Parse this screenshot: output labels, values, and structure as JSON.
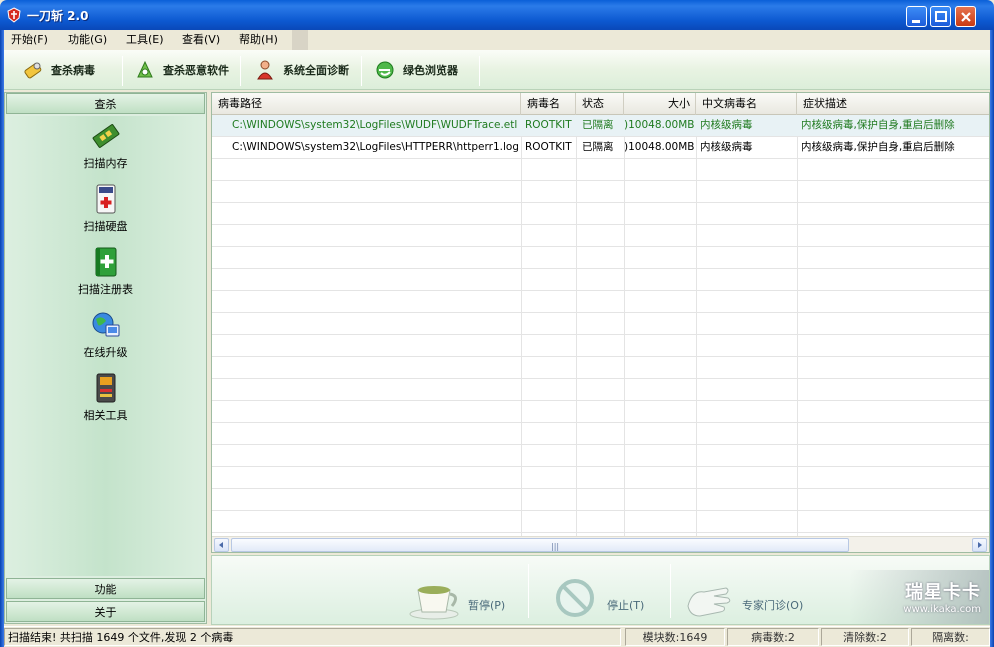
{
  "window": {
    "title": "一刀斩 2.0"
  },
  "menu": [
    {
      "label": "开始(F)"
    },
    {
      "label": "功能(G)"
    },
    {
      "label": "工具(E)"
    },
    {
      "label": "查看(V)"
    },
    {
      "label": "帮助(H)"
    }
  ],
  "toolbar": [
    {
      "label": "查杀病毒",
      "icon": "antivirus-scan-icon"
    },
    {
      "label": "查杀恶意软件",
      "icon": "malware-scan-icon"
    },
    {
      "label": "系统全面诊断",
      "icon": "system-diagnose-icon"
    },
    {
      "label": "绿色浏览器",
      "icon": "green-browser-icon"
    }
  ],
  "sidebar": {
    "active_section": "查杀",
    "items": [
      {
        "label": "扫描内存",
        "icon": "memory-chip-icon"
      },
      {
        "label": "扫描硬盘",
        "icon": "disk-icon"
      },
      {
        "label": "扫描注册表",
        "icon": "registry-book-icon"
      },
      {
        "label": "在线升级",
        "icon": "globe-update-icon"
      },
      {
        "label": "相关工具",
        "icon": "tools-icon"
      }
    ],
    "sections_bottom": [
      "功能",
      "关于"
    ]
  },
  "table": {
    "columns": [
      "病毒路径",
      "病毒名",
      "状态",
      "大小",
      "中文病毒名",
      "症状描述"
    ],
    "rows": [
      {
        "path": "C:\\WINDOWS\\system32\\LogFiles\\WUDF\\WUDFTrace.etl",
        "name": "ROOTKIT",
        "status": "已隔离",
        "size": ")10048.00MB",
        "cn_name": "内核级病毒",
        "desc": "内核级病毒,保护自身,重启后删除"
      },
      {
        "path": "C:\\WINDOWS\\system32\\LogFiles\\HTTPERR\\httperr1.log",
        "name": "ROOTKIT",
        "status": "已隔离",
        "size": ")10048.00MB",
        "cn_name": "内核级病毒",
        "desc": "内核级病毒,保护自身,重启后删除"
      }
    ]
  },
  "actions": [
    {
      "label": "暂停(P)",
      "icon": "coffee-cup-icon"
    },
    {
      "label": "停止(T)",
      "icon": "stop-sign-icon"
    },
    {
      "label": "专家门诊(O)",
      "icon": "hand-icon"
    }
  ],
  "watermark": {
    "line1": "瑞星卡卡",
    "line2": "www.ikaka.com"
  },
  "status": {
    "message": "扫描结束! 共扫描 1649 个文件,发现 2 个病毒",
    "modules": "模块数:1649",
    "viruses": "病毒数:2",
    "cleared": "清除数:2",
    "quarantined": "隔离数:"
  },
  "colors": {
    "selected_row_text": "#1F7A1F",
    "normal_row_text": "#000000",
    "panel_green": "#C4E3CB",
    "titlebar_blue": "#0C58D0"
  }
}
